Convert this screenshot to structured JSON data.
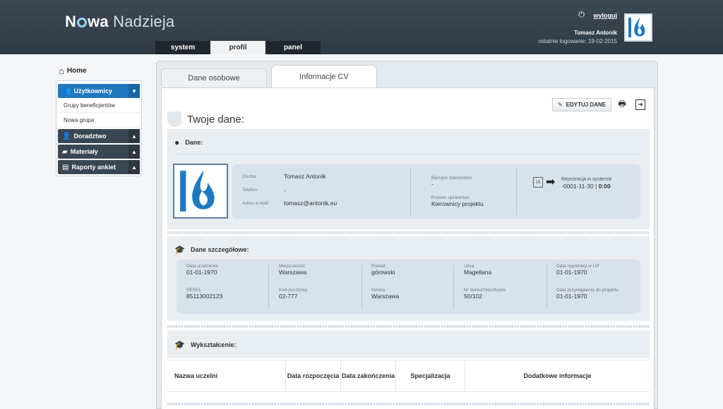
{
  "header": {
    "logo_bold": "N",
    "logo_bold2": "wa",
    "logo_light": "Nadzieja",
    "logout_label": "wyloguj",
    "user_name": "Tomasz Antonik",
    "last_login": "ostatnie logowanie: 19-02-2015",
    "tabs": [
      {
        "label": "system"
      },
      {
        "label": "profil"
      },
      {
        "label": "panel"
      }
    ]
  },
  "sidebar": {
    "home_label": "Home",
    "items": [
      {
        "label": "Użytkownicy",
        "icon": "users-icon"
      },
      {
        "label": "Doradztwo",
        "icon": "advisor-icon"
      },
      {
        "label": "Materiały",
        "icon": "folder-icon"
      },
      {
        "label": "Raporty ankiet",
        "icon": "chart-icon"
      }
    ],
    "subitems": [
      {
        "label": "Grupy beneficjentów"
      },
      {
        "label": "Nowa grupa"
      }
    ]
  },
  "content_tabs": [
    {
      "label": "Dane osobowe"
    },
    {
      "label": "Informacje CV"
    }
  ],
  "toolbar": {
    "edit_label": "EDYTUJ DANE"
  },
  "page_title": "Twoje dane:",
  "dane": {
    "heading": "Dane:",
    "osoba_label": "Osoba:",
    "osoba_value": "Tomasz Antonik",
    "telefon_label": "Telefon:",
    "telefon_value": "-",
    "email_label": "Adres e-mail:",
    "email_value": "tomasz@antonik.eu",
    "stanowisko_label": "Bieżące stanowisko",
    "stanowisko_value": "-",
    "poziom_label": "Poziom uprawnień:",
    "poziom_value": "Kierownicy projektu",
    "rejestracja_label": "Rejestracja w systemie",
    "rejestracja_date": "-0001-11-30",
    "rejestracja_sep": "|",
    "rejestracja_time": "0:00",
    "calendar_day": "15"
  },
  "szczegolowe": {
    "heading": "Dane szczegółowe:",
    "fields": [
      {
        "label": "Data urodzenia",
        "value": "01-01-1970"
      },
      {
        "label": "Miejscowość",
        "value": "Warszawa"
      },
      {
        "label": "Powiat",
        "value": "górowski"
      },
      {
        "label": "Ulica",
        "value": "Magellana"
      },
      {
        "label": "Data rejestracji w UP",
        "value": "01-01-1970"
      },
      {
        "label": "PESEL",
        "value": "85113002123"
      },
      {
        "label": "Kod pocztowy",
        "value": "02-777"
      },
      {
        "label": "Gmina",
        "value": "Warszawa"
      },
      {
        "label": "Nr domu/mieszkanie",
        "value": "50/102"
      },
      {
        "label": "Data przystąpienia do projektu",
        "value": "01-01-1970"
      }
    ]
  },
  "wyksztalcenie": {
    "heading": "Wykształcenie:",
    "columns": [
      {
        "label": "Nazwa uczelni"
      },
      {
        "label": "Data rozpoczęcia"
      },
      {
        "label": "Data zakończenia"
      },
      {
        "label": "Specjalizacja"
      },
      {
        "label": "Dodatkowe informacje"
      }
    ]
  }
}
